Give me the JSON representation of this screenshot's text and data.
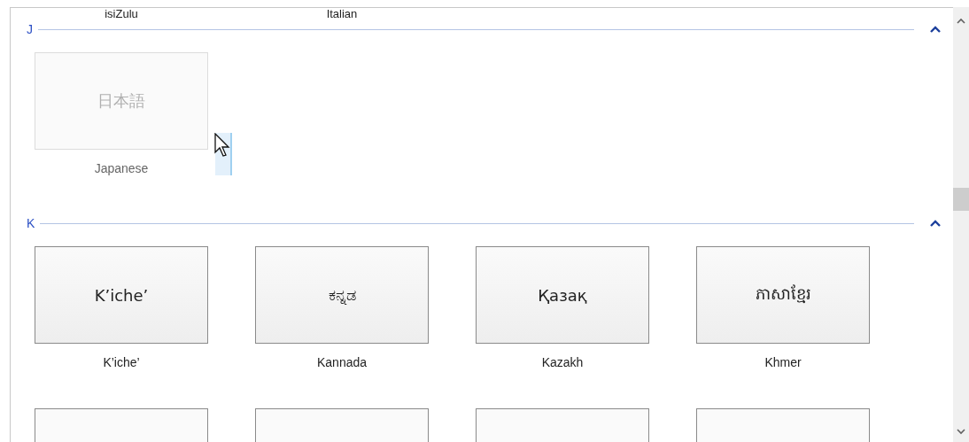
{
  "top_row": [
    {
      "name": "isiZulu"
    },
    {
      "name": "Italian"
    }
  ],
  "sections": [
    {
      "letter": "J",
      "expanded": true,
      "languages": [
        {
          "native": "日本語",
          "name": "Japanese",
          "disabled": true
        }
      ]
    },
    {
      "letter": "K",
      "expanded": true,
      "languages": [
        {
          "native": "K’iche’",
          "name": "K’iche’",
          "disabled": false
        },
        {
          "native": "ಕನ್ನಡ",
          "name": "Kannada",
          "disabled": false
        },
        {
          "native": "Қазақ",
          "name": "Kazakh",
          "disabled": false
        },
        {
          "native": "ភាសាខ្មែរ",
          "name": "Khmer",
          "disabled": false
        }
      ]
    }
  ]
}
